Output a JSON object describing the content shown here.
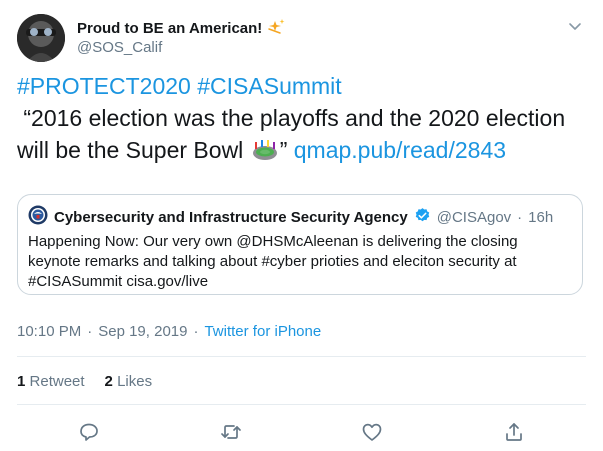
{
  "author": {
    "display_name": "Proud to BE an American!",
    "handle": "@SOS_Calif"
  },
  "tweet": {
    "hashtag1": "#PROTECT2020",
    "hashtag2": "#CISASummit",
    "text_line1": " “2016 election was the playoffs and the 2020 election",
    "text_line2a": "will be the Super Bowl",
    "text_line2b": "”",
    "link": "qmap.pub/read/2843"
  },
  "quoted": {
    "name": "Cybersecurity and Infrastructure Security Agency",
    "handle": "@CISAgov",
    "separator": "·",
    "time": "16h",
    "text": "Happening Now: Our very own @DHSMcAleenan is delivering the closing keynote remarks and talking about #cyber prioties and eleciton security at #CISASummit cisa.gov/live"
  },
  "meta": {
    "time": "10:10 PM",
    "dot1": "·",
    "date": "Sep 19, 2019",
    "dot2": "·",
    "source": "Twitter for iPhone"
  },
  "stats": {
    "retweets_count": "1",
    "retweets_label": "Retweet",
    "likes_count": "2",
    "likes_label": "Likes"
  },
  "icons": [
    "sparkle-icon",
    "chevron-down-icon",
    "stadium-icon",
    "verified-badge-icon",
    "seal-icon",
    "reply-icon",
    "retweet-icon",
    "like-icon",
    "share-icon"
  ],
  "colors": {
    "link": "#1b95e0",
    "muted": "#657786",
    "border": "#ccd6dd",
    "verified": "#1da1f2"
  }
}
